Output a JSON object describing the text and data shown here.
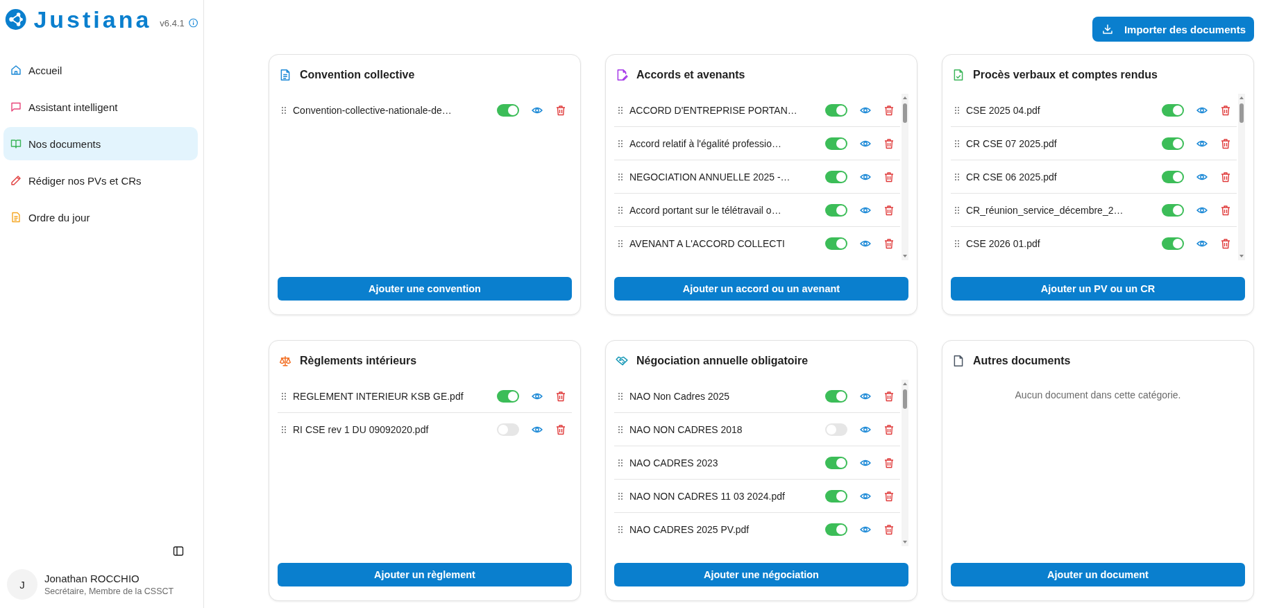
{
  "app": {
    "name": "Justiana",
    "version": "v6.4.1"
  },
  "sidebar": {
    "items": [
      {
        "label": "Accueil",
        "selected": false
      },
      {
        "label": "Assistant intelligent",
        "selected": false
      },
      {
        "label": "Nos documents",
        "selected": true
      },
      {
        "label": "Rédiger nos PVs et CRs",
        "selected": false
      },
      {
        "label": "Ordre du jour",
        "selected": false
      }
    ]
  },
  "user": {
    "initial": "J",
    "name": "Jonathan ROCCHIO",
    "role": "Secrétaire, Membre de la CSSCT"
  },
  "import_button": "Importer des documents",
  "cards": [
    {
      "title": "Convention collective",
      "button": "Ajouter une convention",
      "documents": [
        {
          "name": "Convention-collective-nationale-de…",
          "on": true
        }
      ]
    },
    {
      "title": "Accords et avenants",
      "button": "Ajouter un accord ou un avenant",
      "documents": [
        {
          "name": "ACCORD D'ENTREPRISE PORTAN…",
          "on": true
        },
        {
          "name": "Accord relatif à l'égalité professio…",
          "on": true
        },
        {
          "name": "NEGOCIATION ANNUELLE 2025 -…",
          "on": true
        },
        {
          "name": "Accord portant sur le télétravail o…",
          "on": true
        },
        {
          "name": "AVENANT A L'ACCORD COLLECTI",
          "on": true
        }
      ]
    },
    {
      "title": "Procès verbaux et comptes rendus",
      "button": "Ajouter un PV ou un CR",
      "documents": [
        {
          "name": "CSE 2025 04.pdf",
          "on": true
        },
        {
          "name": "CR CSE 07 2025.pdf",
          "on": true
        },
        {
          "name": "CR CSE 06 2025.pdf",
          "on": true
        },
        {
          "name": "CR_réunion_service_décembre_2…",
          "on": true
        },
        {
          "name": "CSE 2026 01.pdf",
          "on": true
        }
      ]
    },
    {
      "title": "Règlements intérieurs",
      "button": "Ajouter un règlement",
      "documents": [
        {
          "name": "REGLEMENT INTERIEUR KSB GE.pdf",
          "on": true
        },
        {
          "name": "RI CSE rev 1 DU 09092020.pdf",
          "on": false
        }
      ]
    },
    {
      "title": "Négociation annuelle obligatoire",
      "button": "Ajouter une négociation",
      "documents": [
        {
          "name": "NAO Non Cadres 2025",
          "on": true
        },
        {
          "name": "NAO NON CADRES 2018",
          "on": false
        },
        {
          "name": "NAO CADRES 2023",
          "on": true
        },
        {
          "name": "NAO NON CADRES 11 03 2024.pdf",
          "on": true
        },
        {
          "name": "NAO CADRES 2025 PV.pdf",
          "on": true
        }
      ]
    },
    {
      "title": "Autres documents",
      "button": "Ajouter un document",
      "empty_message": "Aucun document dans cette catégorie."
    }
  ]
}
